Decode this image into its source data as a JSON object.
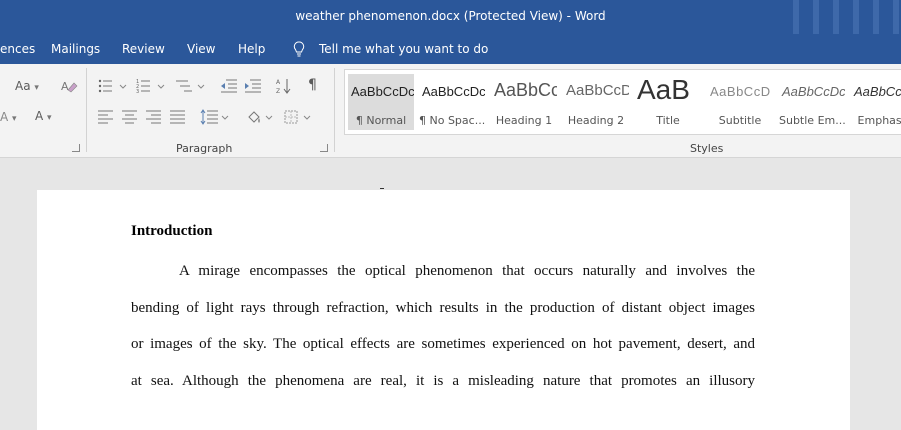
{
  "titlebar": {
    "title": "weather phenomenon.docx (Protected View)  -  Word"
  },
  "ribbon_tabs": [
    "ences",
    "Mailings",
    "Review",
    "View",
    "Help"
  ],
  "tell_me": "Tell me what you want to do",
  "groups": {
    "paragraph": "Paragraph",
    "styles": "Styles"
  },
  "font_controls": {
    "case": "Aa"
  },
  "styles": [
    {
      "preview": "AaBbCcDc",
      "label": "¶ Normal",
      "selected": true
    },
    {
      "preview": "AaBbCcDc",
      "label": "¶ No Spac...",
      "selected": false
    },
    {
      "preview": "AaBbCc",
      "label": "Heading 1",
      "selected": false
    },
    {
      "preview": "AaBbCcD",
      "label": "Heading 2",
      "selected": false
    },
    {
      "preview": "AaB",
      "label": "Title",
      "selected": false
    },
    {
      "preview": "AaBbCcD",
      "label": "Subtitle",
      "selected": false
    },
    {
      "preview": "AaBbCcDc",
      "label": "Subtle Em...",
      "selected": false
    },
    {
      "preview": "AaBbCcDc",
      "label": "Emphasis",
      "selected": false
    }
  ],
  "document": {
    "heading": "Introduction",
    "lines": [
      "A mirage encompasses the optical phenomenon that occurs naturally and involves the",
      "bending of light rays through refraction, which results in the production of distant object images",
      "or images of the sky. The optical effects are sometimes experienced on hot pavement, desert, and",
      "at sea. Although the phenomena are real, it is a misleading nature that promotes an illusory"
    ]
  },
  "colors": {
    "accent": "#2b579a",
    "ribbon_bg": "#f3f3f3",
    "doc_bg": "#e6e6e6"
  }
}
